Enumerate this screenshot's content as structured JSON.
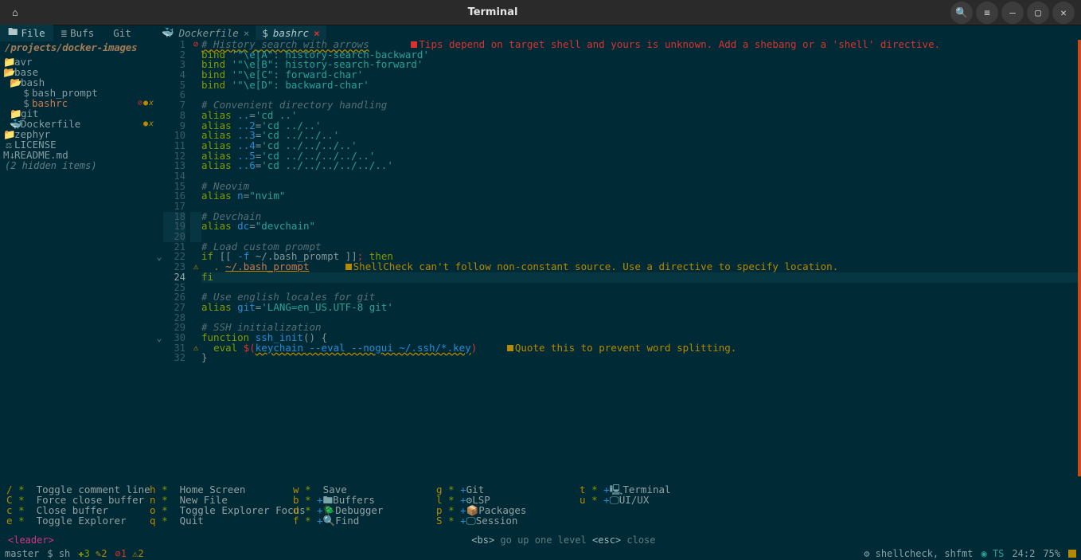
{
  "titlebar": {
    "title": "Terminal"
  },
  "sidebar": {
    "tabs": {
      "file": "File",
      "bufs": "Bufs",
      "git": "Git"
    },
    "path": "/projects/docker-images",
    "tree": [
      {
        "icon": "📁",
        "label": "avr",
        "cls": "folder",
        "depth": 0
      },
      {
        "icon": "📂",
        "label": "base",
        "cls": "folder",
        "depth": 0
      },
      {
        "icon": "📂",
        "label": "bash",
        "cls": "folder",
        "depth": 1
      },
      {
        "icon": "$",
        "label": "bash_prompt",
        "cls": "file",
        "depth": 2
      },
      {
        "icon": "$",
        "label": "bashrc",
        "cls": "file selected-row",
        "depth": 2,
        "markers": [
          "⊘",
          "●",
          "x"
        ]
      },
      {
        "icon": "📁",
        "label": "git",
        "cls": "folder",
        "depth": 1
      },
      {
        "icon": "🐳",
        "label": "Dockerfile",
        "cls": "file",
        "depth": 1,
        "markers": [
          "●",
          "x"
        ]
      },
      {
        "icon": "📁",
        "label": "zephyr",
        "cls": "folder",
        "depth": 0
      },
      {
        "icon": "⚖",
        "label": "LICENSE",
        "cls": "file",
        "depth": 0
      },
      {
        "icon": "M↓",
        "label": "README.md",
        "cls": "file",
        "depth": 0
      }
    ],
    "hidden": "(2 hidden items)"
  },
  "tabs": [
    {
      "icon": "🐳",
      "label": "Dockerfile",
      "close": "×",
      "active": false
    },
    {
      "icon": "$",
      "label": "bashrc",
      "close": "×",
      "active": true
    }
  ],
  "code": {
    "lines": [
      {
        "n": 1,
        "sign": "⊘",
        "signcls": "err-sign",
        "html": "<span class='c-cmt c-uline'># History search with arrows</span>       <span class='sq-red'></span><span class='c-lint-err'>Tips depend on target shell and yours is unknown. Add a shebang or a 'shell' directive.</span>"
      },
      {
        "n": 2,
        "html": "<span class='c-kw'>bind</span> <span class='c-str'>'\"\\e[A\": history-search-backward'</span>"
      },
      {
        "n": 3,
        "html": "<span class='c-kw'>bind</span> <span class='c-str'>'\"\\e[B\": history-search-forward'</span>"
      },
      {
        "n": 4,
        "html": "<span class='c-kw'>bind</span> <span class='c-str'>'\"\\e[C\": forward-char'</span>"
      },
      {
        "n": 5,
        "html": "<span class='c-kw'>bind</span> <span class='c-str'>'\"\\e[D\": backward-char'</span>"
      },
      {
        "n": 6,
        "html": ""
      },
      {
        "n": 7,
        "html": "<span class='c-cmt'># Convenient directory handling</span>"
      },
      {
        "n": 8,
        "html": "<span class='c-kw'>alias</span> <span class='c-id'>..</span><span class='c-punc'>=</span><span class='c-str'>'cd ..'</span>"
      },
      {
        "n": 9,
        "html": "<span class='c-kw'>alias</span> <span class='c-id'>..2</span><span class='c-punc'>=</span><span class='c-str'>'cd ../..'</span>"
      },
      {
        "n": 10,
        "html": "<span class='c-kw'>alias</span> <span class='c-id'>..3</span><span class='c-punc'>=</span><span class='c-str'>'cd ../../..'</span>"
      },
      {
        "n": 11,
        "html": "<span class='c-kw'>alias</span> <span class='c-id'>..4</span><span class='c-punc'>=</span><span class='c-str'>'cd ../../../..'</span>"
      },
      {
        "n": 12,
        "html": "<span class='c-kw'>alias</span> <span class='c-id'>..5</span><span class='c-punc'>=</span><span class='c-str'>'cd ../../../../..'</span>"
      },
      {
        "n": 13,
        "html": "<span class='c-kw'>alias</span> <span class='c-id'>..6</span><span class='c-punc'>=</span><span class='c-str'>'cd ../../../../../..'</span>"
      },
      {
        "n": 14,
        "html": ""
      },
      {
        "n": 15,
        "html": "<span class='c-cmt'># Neovim</span>"
      },
      {
        "n": 16,
        "html": "<span class='c-kw'>alias</span> <span class='c-id'>n</span><span class='c-punc'>=</span><span class='c-str'>\"nvim\"</span>"
      },
      {
        "n": 17,
        "html": ""
      },
      {
        "n": 18,
        "git": true,
        "html": "<span class='c-cmt'># Devchain</span>"
      },
      {
        "n": 19,
        "git": true,
        "html": "<span class='c-kw'>alias</span> <span class='c-id'>dc</span><span class='c-punc'>=</span><span class='c-str'>\"devchain\"</span>"
      },
      {
        "n": 20,
        "git": true,
        "html": ""
      },
      {
        "n": 21,
        "html": "<span class='c-cmt'># Load custom prompt</span>"
      },
      {
        "n": 22,
        "fold": "⌄",
        "html": "<span class='c-kw'>if</span> <span class='c-punc'>[[</span> <span class='c-id'>-f</span> <span class='c-punc'>~/.bash_prompt</span> <span class='c-punc'>]]</span><span class='c-op'>;</span> <span class='c-kw'>then</span>"
      },
      {
        "n": 23,
        "sign": "⚠",
        "signcls": "warn-sign",
        "html": "  <span class='c-kw'>.</span> <span class='c-uline-strike'>~/.bash_prompt</span>      <span class='sq-yel'></span><span class='c-lint-warn'>ShellCheck can't follow non-constant source. Use a directive to specify location.</span>"
      },
      {
        "n": 24,
        "cursor": true,
        "html": "<span class='c-kw'>fi</span>"
      },
      {
        "n": 25,
        "html": ""
      },
      {
        "n": 26,
        "html": "<span class='c-cmt'># Use english locales for git</span>"
      },
      {
        "n": 27,
        "html": "<span class='c-kw'>alias</span> <span class='c-id'>git</span><span class='c-punc'>=</span><span class='c-str'>'LANG=en_US.UTF-8 git'</span>"
      },
      {
        "n": 28,
        "html": ""
      },
      {
        "n": 29,
        "html": "<span class='c-cmt'># SSH initialization</span>"
      },
      {
        "n": 30,
        "fold": "⌄",
        "html": "<span class='c-kw'>function</span> <span class='c-id'>ssh_init</span><span class='c-punc'>()</span> <span class='c-punc'>{</span>"
      },
      {
        "n": 31,
        "sign": "⚠",
        "signcls": "warn-sign",
        "html": "  <span class='c-kw'>eval</span> <span class='c-op'>$(</span><span class='c-uline' style='color:#268bd2;'>keychain --eval --nogui ~/.ssh/*.key</span><span class='c-op'>)</span>     <span class='sq-yel'></span><span class='c-lint-warn'>Quote this to prevent word splitting.</span>"
      },
      {
        "n": 32,
        "html": "<span class='c-punc'>}</span>"
      }
    ]
  },
  "whichkey": {
    "cols": [
      [
        {
          "k": "/",
          "l": "Toggle comment line"
        },
        {
          "k": "C",
          "l": "Force close buffer"
        },
        {
          "k": "c",
          "l": "Close buffer"
        },
        {
          "k": "e",
          "l": "Toggle Explorer"
        }
      ],
      [
        {
          "k": "h",
          "l": "Home Screen"
        },
        {
          "k": "n",
          "l": "New File"
        },
        {
          "k": "o",
          "l": "Toggle Explorer Focus"
        },
        {
          "k": "q",
          "l": "Quit"
        }
      ],
      [
        {
          "k": "w",
          "l": "Save"
        },
        {
          "k": "b",
          "plus": true,
          "ico": "🖿",
          "l": "Buffers"
        },
        {
          "k": "d",
          "plus": true,
          "ico": "🪲",
          "l": "Debugger"
        },
        {
          "k": "f",
          "plus": true,
          "ico": "🔍",
          "l": "Find"
        }
      ],
      [
        {
          "k": "g",
          "plus": true,
          "ico": "",
          "l": "Git"
        },
        {
          "k": "l",
          "plus": true,
          "ico": "⚙",
          "l": "LSP"
        },
        {
          "k": "p",
          "plus": true,
          "ico": "📦",
          "l": "Packages"
        },
        {
          "k": "S",
          "plus": true,
          "ico": "🖵",
          "l": "Session"
        }
      ],
      [
        {
          "k": "t",
          "plus": true,
          "ico": "🖳",
          "l": "Terminal"
        },
        {
          "k": "u",
          "plus": true,
          "ico": "🖵",
          "l": "UI/UX"
        }
      ]
    ],
    "leader": "<leader>",
    "hint": "<bs> go up one level <esc> close"
  },
  "status": {
    "branch": "master",
    "ft_icon": "$",
    "ft": "sh",
    "git_add": "3",
    "git_mod": "2",
    "diag_err": "1",
    "diag_warn": "2",
    "lsp": "shellcheck, shfmt",
    "ts": "TS",
    "pos": "24:2",
    "pct": "75%"
  }
}
